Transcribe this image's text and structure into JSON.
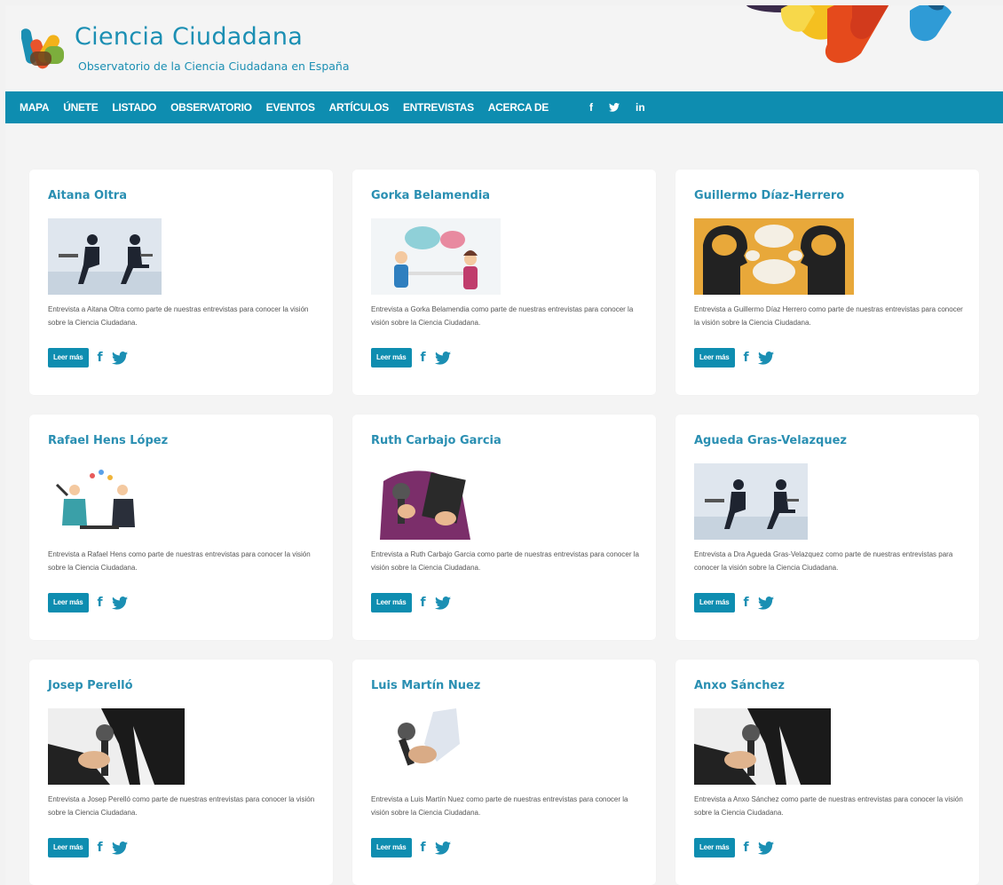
{
  "header": {
    "title": "Ciencia Ciudadana",
    "subtitle": "Observatorio de la Ciencia Ciudadana en España"
  },
  "nav": {
    "items": [
      "MAPA",
      "ÚNETE",
      "LISTADO",
      "OBSERVATORIO",
      "EVENTOS",
      "ARTÍCULOS",
      "ENTREVISTAS",
      "ACERCA DE"
    ],
    "social": [
      "f",
      "twitter",
      "in"
    ]
  },
  "colors": {
    "brand": "#0e8db0",
    "title": "#1b8fb3",
    "background": "#f4f4f4"
  },
  "cards": [
    {
      "name": "Aitana Oltra",
      "image": "interview-silhouettes",
      "text": "Entrevista a Aitana Oltra como parte de nuestras entrevistas para conocer la visión sobre la Ciencia Ciudadana.",
      "button": "Leer más"
    },
    {
      "name": "Gorka Belamendia",
      "image": "chat-bubbles-illustration",
      "text": "Entrevista a Gorka Belamendia como parte de nuestras entrevistas para conocer la visión sobre la Ciencia Ciudadana.",
      "button": "Leer más"
    },
    {
      "name": "Guillermo Díaz-Herrero",
      "image": "heads-thinking-illustration",
      "text": "Entrevista a Guillermo Díaz Herrero como parte de nuestras entrevistas para conocer la visión sobre la Ciencia Ciudadana.",
      "button": "Leer más"
    },
    {
      "name": "Rafael Hens López",
      "image": "talk-illustration",
      "text": "Entrevista a Rafael Hens como parte de nuestras entrevistas para conocer la visión sobre la Ciencia Ciudadana.",
      "button": "Leer más"
    },
    {
      "name": "Ruth Carbajo Garcia",
      "image": "microphone-clipboard-photo",
      "text": "Entrevista a Ruth Carbajo Garcia como parte de nuestras entrevistas para conocer la visión sobre la Ciencia Ciudadana.",
      "button": "Leer más"
    },
    {
      "name": "Agueda Gras-Velazquez",
      "image": "interview-silhouettes",
      "text": "Entrevista a Dra Agueda Gras-Velazquez como parte de nuestras entrevistas para conocer la visión sobre la Ciencia Ciudadana.",
      "button": "Leer más"
    },
    {
      "name": "Josep Perelló",
      "image": "microphone-photo",
      "text": "Entrevista a Josep Perelló como parte de nuestras entrevistas para conocer la visión sobre la Ciencia Ciudadana.",
      "button": "Leer más"
    },
    {
      "name": "Luis Martín Nuez",
      "image": "hand-microphone-photo",
      "text": "Entrevista a Luis Martín Nuez como parte de nuestras entrevistas para conocer la visión sobre la Ciencia Ciudadana.",
      "button": "Leer más"
    },
    {
      "name": "Anxo Sánchez",
      "image": "microphone-photo",
      "text": "Entrevista a Anxo Sánchez como parte de nuestras entrevistas para conocer la visión sobre la Ciencia Ciudadana.",
      "button": "Leer más"
    }
  ]
}
